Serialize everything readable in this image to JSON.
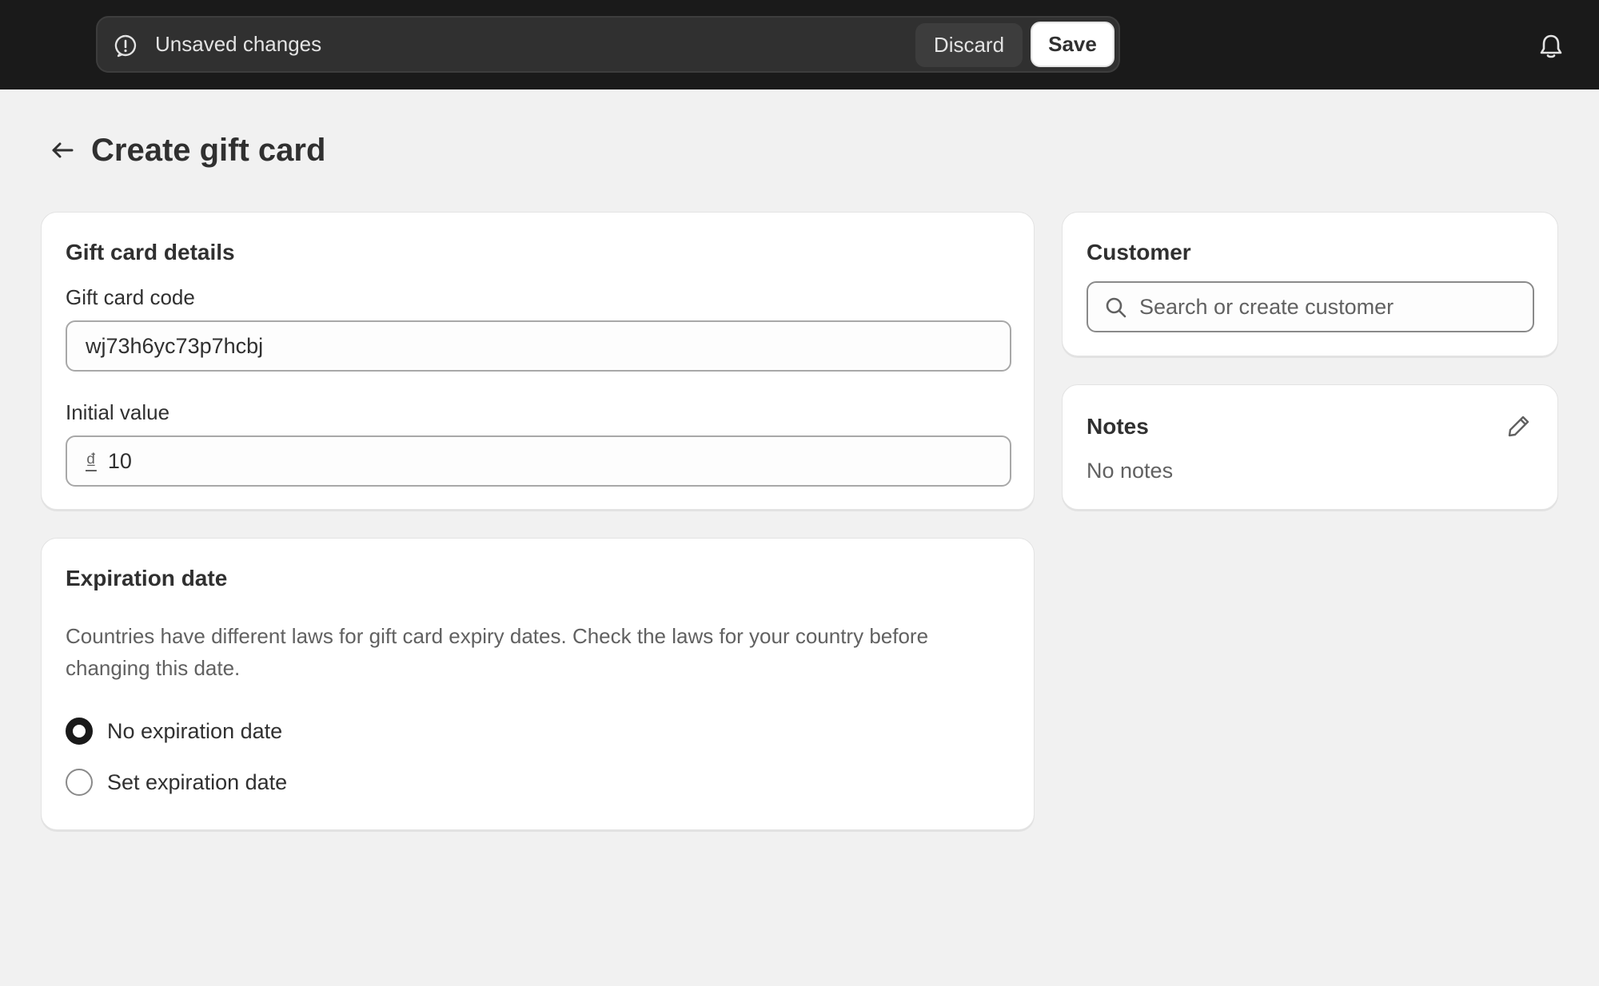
{
  "savebar": {
    "message": "Unsaved changes",
    "discard_label": "Discard",
    "save_label": "Save"
  },
  "page": {
    "title": "Create gift card"
  },
  "gift_card_details": {
    "title": "Gift card details",
    "code_label": "Gift card code",
    "code_value": "wj73h6yc73p7hcbj",
    "initial_value_label": "Initial value",
    "currency_symbol": "₫",
    "initial_value": "10"
  },
  "expiration": {
    "title": "Expiration date",
    "description": "Countries have different laws for gift card expiry dates. Check the laws for your country before changing this date.",
    "options": [
      {
        "label": "No expiration date",
        "checked": true
      },
      {
        "label": "Set expiration date",
        "checked": false
      }
    ]
  },
  "customer": {
    "title": "Customer",
    "search_placeholder": "Search or create customer"
  },
  "notes": {
    "title": "Notes",
    "empty_text": "No notes"
  },
  "icons": {
    "savebar": "alert-circle-icon",
    "topbar_right": "bell-icon",
    "back": "arrow-left-icon",
    "customer_search": "search-icon",
    "notes_edit": "pencil-icon"
  }
}
